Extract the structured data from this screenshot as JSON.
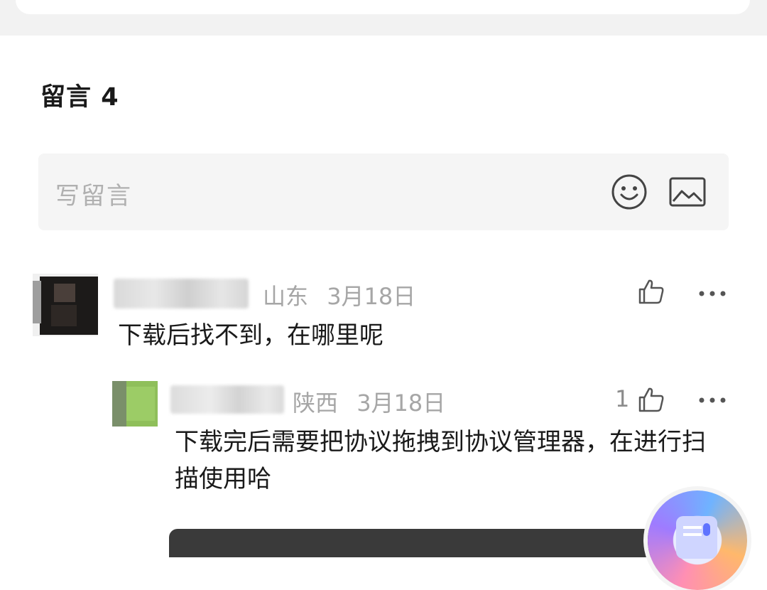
{
  "comments_section": {
    "title": "留言",
    "count": "4"
  },
  "write_box": {
    "placeholder": "写留言",
    "emoji_icon": "emoji-icon",
    "image_icon": "image-icon"
  },
  "comments": [
    {
      "location": "山东",
      "date": "3月18日",
      "text": "下载后找不到，在哪里呢",
      "like_count": ""
    }
  ],
  "replies": [
    {
      "location": "陕西",
      "date": "3月18日",
      "text": "下载完后需要把协议拖拽到协议管理器，在进行扫描使用哈",
      "like_count": "1"
    }
  ],
  "colors": {
    "text": "#1a1a1a",
    "meta": "#a6a6a6",
    "input_bg": "#f5f5f5"
  }
}
